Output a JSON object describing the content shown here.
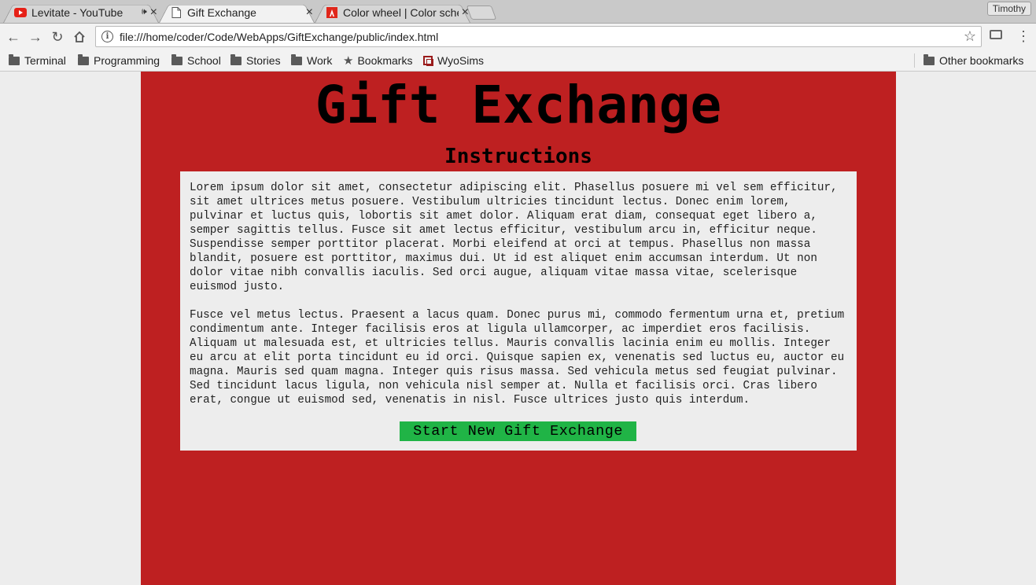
{
  "browser": {
    "tabs": [
      {
        "title": "Levitate - YouTube",
        "icon": "youtube-icon"
      },
      {
        "title": "Gift Exchange",
        "icon": "page-icon"
      },
      {
        "title": "Color wheel | Color schemes",
        "icon": "adobe-icon"
      }
    ],
    "profile": "Timothy",
    "url": "file:///home/coder/Code/WebApps/GiftExchange/public/index.html",
    "bookmarks": [
      "Terminal",
      "Programming",
      "School",
      "Stories",
      "Work",
      "Bookmarks",
      "WyoSims"
    ],
    "other_bookmarks": "Other bookmarks"
  },
  "page": {
    "title": "Gift Exchange",
    "subtitle": "Instructions",
    "paragraphs": [
      "Lorem ipsum dolor sit amet, consectetur adipiscing elit. Phasellus posuere mi vel sem efficitur, sit amet ultrices metus posuere. Vestibulum ultricies tincidunt lectus. Donec enim lorem, pulvinar et luctus quis, lobortis sit amet dolor. Aliquam erat diam, consequat eget libero a, semper sagittis tellus. Fusce sit amet lectus efficitur, vestibulum arcu in, efficitur neque. Suspendisse semper porttitor placerat. Morbi eleifend at orci at tempus. Phasellus non massa blandit, posuere est porttitor, maximus dui. Ut id est aliquet enim accumsan interdum. Ut non dolor vitae nibh convallis iaculis. Sed orci augue, aliquam vitae massa vitae, scelerisque euismod justo.",
      "Fusce vel metus lectus. Praesent a lacus quam. Donec purus mi, commodo fermentum urna et, pretium condimentum ante. Integer facilisis eros at ligula ullamcorper, ac imperdiet eros facilisis. Aliquam ut malesuada est, et ultricies tellus. Mauris convallis lacinia enim eu mollis. Integer eu arcu at elit porta tincidunt eu id orci. Quisque sapien ex, venenatis sed luctus eu, auctor eu magna. Mauris sed quam magna. Integer quis risus massa. Sed vehicula metus sed feugiat pulvinar. Sed tincidunt lacus ligula, non vehicula nisl semper at. Nulla et facilisis orci. Cras libero erat, congue ut euismod sed, venenatis in nisl. Fusce ultrices justo quis interdum."
    ],
    "start_button": "Start New Gift Exchange"
  },
  "colors": {
    "page_background": "#be2021",
    "panel_background": "#ededed",
    "button_background": "#20b446"
  }
}
